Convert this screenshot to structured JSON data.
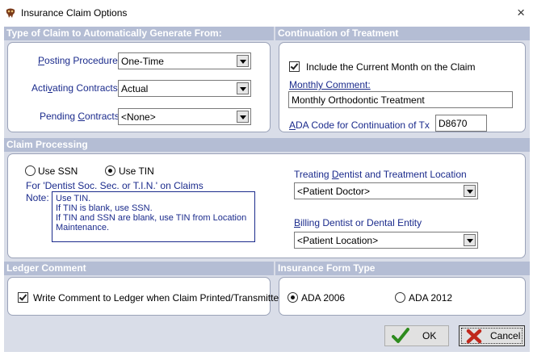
{
  "window": {
    "title": "Insurance Claim Options",
    "icon": "tooth-app-icon",
    "close_glyph": "×"
  },
  "type_of_claim": {
    "header": "Type of Claim to Automatically Generate From:",
    "posting_procedures": {
      "label": "Posting Procedures",
      "value": "One-Time"
    },
    "activating_contracts": {
      "label": "Activating Contracts",
      "value": "Actual"
    },
    "pending_contracts": {
      "label": "Pending Contracts",
      "value": "<None>"
    }
  },
  "continuation": {
    "header": "Continuation of Treatment",
    "include_current_month": {
      "label": "Include the Current Month on the Claim",
      "checked": true
    },
    "monthly_comment": {
      "label": "Monthly Comment:",
      "value": "Monthly Orthodontic Treatment"
    },
    "ada_code": {
      "label": "ADA Code for Continuation of Tx",
      "value": "D8670"
    }
  },
  "claim_processing": {
    "header": "Claim Processing",
    "use_ssn": {
      "label": "Use SSN",
      "selected": false
    },
    "use_tin": {
      "label": "Use TIN",
      "selected": true
    },
    "dentist_note_caption": "For 'Dentist Soc. Sec. or T.I.N.' on Claims",
    "note_label": "Note:",
    "note_lines": [
      "Use TIN.",
      "If TIN is blank, use SSN.",
      "If TIN and SSN are blank, use TIN from Location",
      "Maintenance."
    ],
    "treating_dentist": {
      "label": "Treating Dentist and Treatment Location",
      "value": "<Patient Doctor>"
    },
    "billing_dentist": {
      "label": "Billing Dentist or Dental Entity",
      "value": "<Patient Location>"
    }
  },
  "ledger_comment": {
    "header": "Ledger Comment",
    "write_comment": {
      "label": "Write Comment to Ledger when Claim Printed/Transmitted",
      "checked": true
    }
  },
  "insurance_form_type": {
    "header": "Insurance Form Type",
    "ada_2006": {
      "label": "ADA 2006",
      "selected": true
    },
    "ada_2012": {
      "label": "ADA 2012",
      "selected": false
    }
  },
  "buttons": {
    "ok": "OK",
    "cancel": "Cancel"
  },
  "colors": {
    "header_bg": "#b4bdd4",
    "client_bg": "#d9dde8",
    "label_blue": "#1b2b8c"
  }
}
